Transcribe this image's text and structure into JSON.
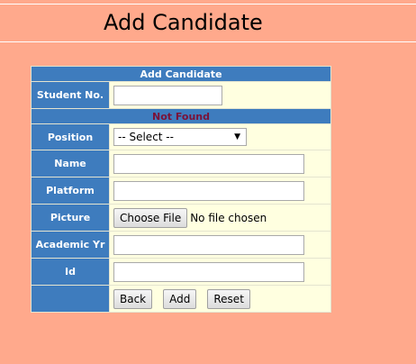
{
  "page": {
    "title": "Add Candidate"
  },
  "form": {
    "header": "Add Candidate",
    "student_no_label": "Student No.",
    "student_no_value": "",
    "status_message": "Not Found",
    "position_label": "Position",
    "position_selected": "-- Select --",
    "name_label": "Name",
    "name_value": "",
    "platform_label": "Platform",
    "platform_value": "",
    "picture_label": "Picture",
    "choose_file_label": "Choose File",
    "no_file_text": "No file chosen",
    "academic_yr_label": "Academic Yr",
    "academic_yr_value": "",
    "id_label": "Id",
    "id_value": "",
    "back_label": "Back",
    "add_label": "Add",
    "reset_label": "Reset"
  },
  "colors": {
    "page_background": "#ffa98c",
    "header_blue": "#3e7cbe",
    "field_background": "#ffffe0",
    "status_text": "#7a1238"
  },
  "icons": {
    "select_arrow": "chevron-down-icon"
  }
}
